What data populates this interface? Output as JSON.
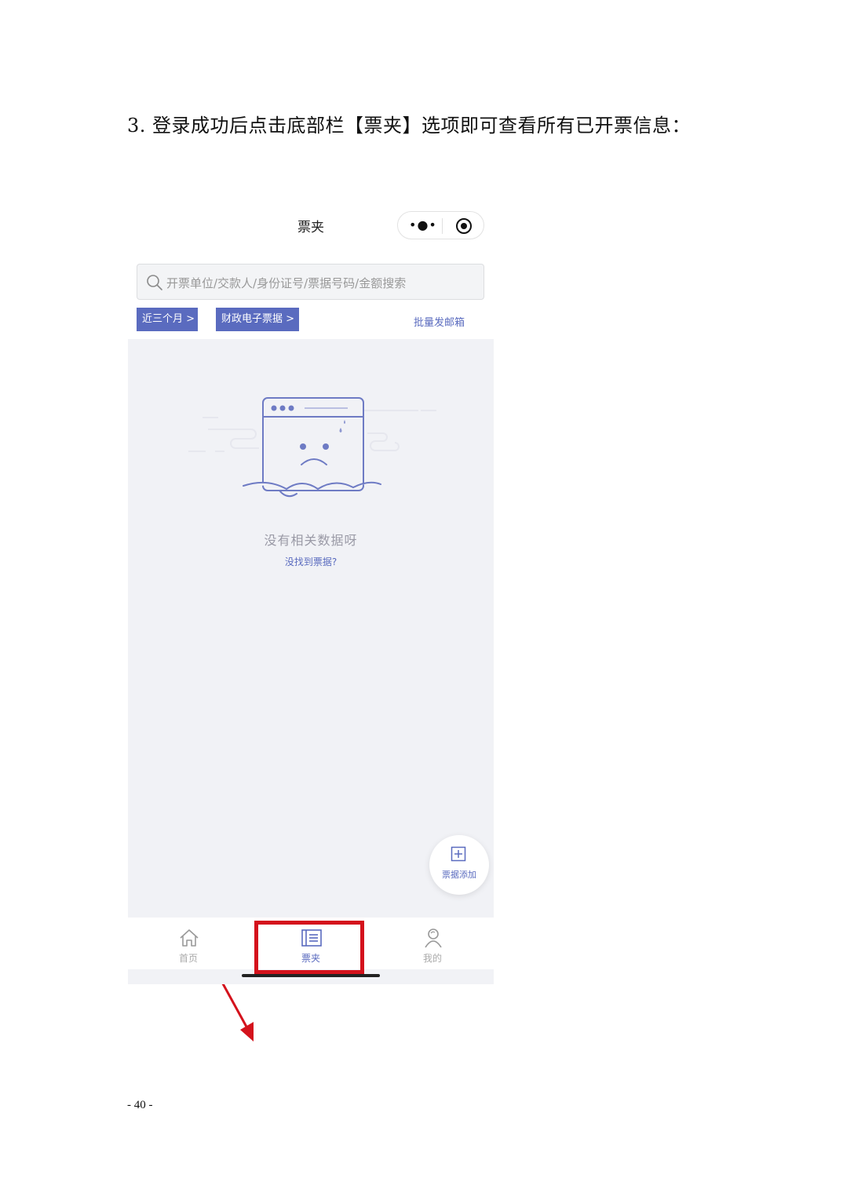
{
  "doc": {
    "heading": "3. 登录成功后点击底部栏【票夹】选项即可查看所有已开票信息：",
    "page_number": "- 40 -"
  },
  "phone": {
    "nav_title": "票夹",
    "capsule_dots": "•●•",
    "search_placeholder": "开票单位/交款人/身份证号/票据号码/金额搜索",
    "filter_recent": "近三个月 >",
    "filter_type": "财政电子票据 >",
    "batch_send": "批量发邮箱",
    "empty_title": "没有相关数据呀",
    "empty_link": "没找到票据?",
    "fab_label": "票据添加",
    "tabs": [
      {
        "label": "首页",
        "icon": "home-icon"
      },
      {
        "label": "票夹",
        "icon": "ticket-folder-icon",
        "active": true
      },
      {
        "label": "我的",
        "icon": "user-icon"
      }
    ]
  },
  "colors": {
    "accent": "#5a6bbf",
    "highlight": "#d4121c",
    "background": "#f1f2f6"
  }
}
